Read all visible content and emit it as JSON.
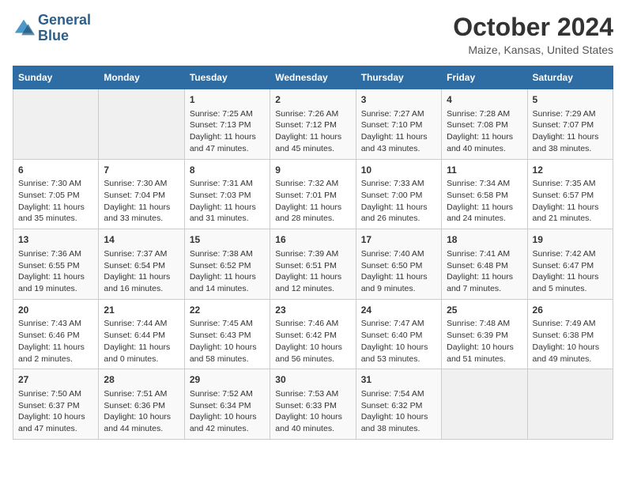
{
  "logo": {
    "line1": "General",
    "line2": "Blue"
  },
  "title": "October 2024",
  "subtitle": "Maize, Kansas, United States",
  "weekdays": [
    "Sunday",
    "Monday",
    "Tuesday",
    "Wednesday",
    "Thursday",
    "Friday",
    "Saturday"
  ],
  "weeks": [
    [
      {
        "num": "",
        "info": ""
      },
      {
        "num": "",
        "info": ""
      },
      {
        "num": "1",
        "info": "Sunrise: 7:25 AM\nSunset: 7:13 PM\nDaylight: 11 hours and 47 minutes."
      },
      {
        "num": "2",
        "info": "Sunrise: 7:26 AM\nSunset: 7:12 PM\nDaylight: 11 hours and 45 minutes."
      },
      {
        "num": "3",
        "info": "Sunrise: 7:27 AM\nSunset: 7:10 PM\nDaylight: 11 hours and 43 minutes."
      },
      {
        "num": "4",
        "info": "Sunrise: 7:28 AM\nSunset: 7:08 PM\nDaylight: 11 hours and 40 minutes."
      },
      {
        "num": "5",
        "info": "Sunrise: 7:29 AM\nSunset: 7:07 PM\nDaylight: 11 hours and 38 minutes."
      }
    ],
    [
      {
        "num": "6",
        "info": "Sunrise: 7:30 AM\nSunset: 7:05 PM\nDaylight: 11 hours and 35 minutes."
      },
      {
        "num": "7",
        "info": "Sunrise: 7:30 AM\nSunset: 7:04 PM\nDaylight: 11 hours and 33 minutes."
      },
      {
        "num": "8",
        "info": "Sunrise: 7:31 AM\nSunset: 7:03 PM\nDaylight: 11 hours and 31 minutes."
      },
      {
        "num": "9",
        "info": "Sunrise: 7:32 AM\nSunset: 7:01 PM\nDaylight: 11 hours and 28 minutes."
      },
      {
        "num": "10",
        "info": "Sunrise: 7:33 AM\nSunset: 7:00 PM\nDaylight: 11 hours and 26 minutes."
      },
      {
        "num": "11",
        "info": "Sunrise: 7:34 AM\nSunset: 6:58 PM\nDaylight: 11 hours and 24 minutes."
      },
      {
        "num": "12",
        "info": "Sunrise: 7:35 AM\nSunset: 6:57 PM\nDaylight: 11 hours and 21 minutes."
      }
    ],
    [
      {
        "num": "13",
        "info": "Sunrise: 7:36 AM\nSunset: 6:55 PM\nDaylight: 11 hours and 19 minutes."
      },
      {
        "num": "14",
        "info": "Sunrise: 7:37 AM\nSunset: 6:54 PM\nDaylight: 11 hours and 16 minutes."
      },
      {
        "num": "15",
        "info": "Sunrise: 7:38 AM\nSunset: 6:52 PM\nDaylight: 11 hours and 14 minutes."
      },
      {
        "num": "16",
        "info": "Sunrise: 7:39 AM\nSunset: 6:51 PM\nDaylight: 11 hours and 12 minutes."
      },
      {
        "num": "17",
        "info": "Sunrise: 7:40 AM\nSunset: 6:50 PM\nDaylight: 11 hours and 9 minutes."
      },
      {
        "num": "18",
        "info": "Sunrise: 7:41 AM\nSunset: 6:48 PM\nDaylight: 11 hours and 7 minutes."
      },
      {
        "num": "19",
        "info": "Sunrise: 7:42 AM\nSunset: 6:47 PM\nDaylight: 11 hours and 5 minutes."
      }
    ],
    [
      {
        "num": "20",
        "info": "Sunrise: 7:43 AM\nSunset: 6:46 PM\nDaylight: 11 hours and 2 minutes."
      },
      {
        "num": "21",
        "info": "Sunrise: 7:44 AM\nSunset: 6:44 PM\nDaylight: 11 hours and 0 minutes."
      },
      {
        "num": "22",
        "info": "Sunrise: 7:45 AM\nSunset: 6:43 PM\nDaylight: 10 hours and 58 minutes."
      },
      {
        "num": "23",
        "info": "Sunrise: 7:46 AM\nSunset: 6:42 PM\nDaylight: 10 hours and 56 minutes."
      },
      {
        "num": "24",
        "info": "Sunrise: 7:47 AM\nSunset: 6:40 PM\nDaylight: 10 hours and 53 minutes."
      },
      {
        "num": "25",
        "info": "Sunrise: 7:48 AM\nSunset: 6:39 PM\nDaylight: 10 hours and 51 minutes."
      },
      {
        "num": "26",
        "info": "Sunrise: 7:49 AM\nSunset: 6:38 PM\nDaylight: 10 hours and 49 minutes."
      }
    ],
    [
      {
        "num": "27",
        "info": "Sunrise: 7:50 AM\nSunset: 6:37 PM\nDaylight: 10 hours and 47 minutes."
      },
      {
        "num": "28",
        "info": "Sunrise: 7:51 AM\nSunset: 6:36 PM\nDaylight: 10 hours and 44 minutes."
      },
      {
        "num": "29",
        "info": "Sunrise: 7:52 AM\nSunset: 6:34 PM\nDaylight: 10 hours and 42 minutes."
      },
      {
        "num": "30",
        "info": "Sunrise: 7:53 AM\nSunset: 6:33 PM\nDaylight: 10 hours and 40 minutes."
      },
      {
        "num": "31",
        "info": "Sunrise: 7:54 AM\nSunset: 6:32 PM\nDaylight: 10 hours and 38 minutes."
      },
      {
        "num": "",
        "info": ""
      },
      {
        "num": "",
        "info": ""
      }
    ]
  ]
}
